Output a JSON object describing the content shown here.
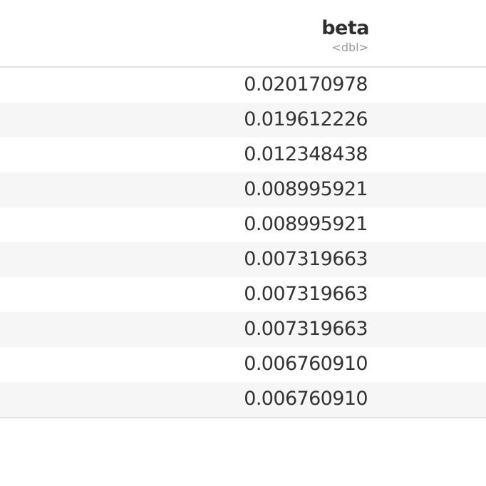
{
  "table": {
    "column": {
      "name": "beta",
      "type": "<dbl>"
    },
    "rows": [
      "0.020170978",
      "0.019612226",
      "0.012348438",
      "0.008995921",
      "0.008995921",
      "0.007319663",
      "0.007319663",
      "0.007319663",
      "0.006760910",
      "0.006760910"
    ]
  }
}
